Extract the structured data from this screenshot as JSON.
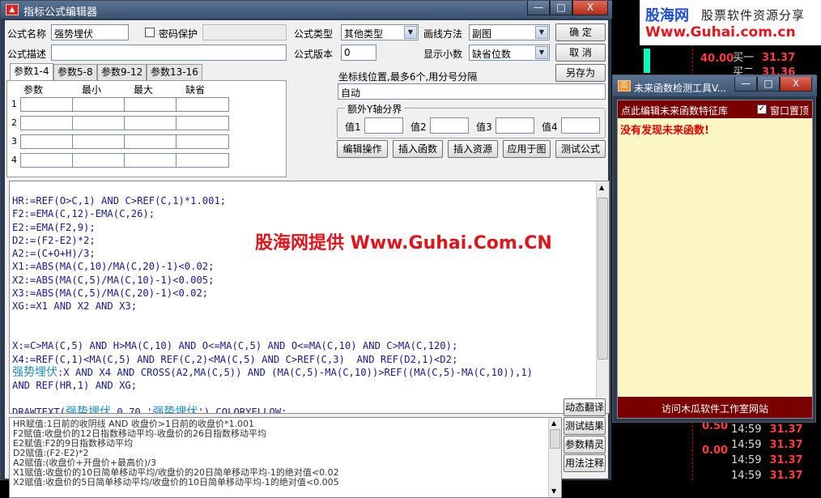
{
  "watermark": {
    "site_cn": "股海网",
    "slogan": "股票软件资源分享",
    "url": "Www.Guhai.com.cn",
    "overlay": "股海网提供 Www.Guhai.Com.CN"
  },
  "background_panel": {
    "rows": [
      {
        "label": "",
        "value": "40.00",
        "color": "#ff3b3b"
      },
      {
        "label": "买一",
        "value": "31.37",
        "color": "#ff3b3b"
      },
      {
        "label": "买二",
        "value": "31.36",
        "color": "#ff3b3b"
      },
      {
        "label": "",
        "value": "0.50",
        "color": "#ff3b3b"
      },
      {
        "label": "",
        "value": "0.00",
        "color": "#ff3b3b"
      },
      {
        "label": "14:59",
        "value": "31.37",
        "color": "#ff3b3b"
      },
      {
        "label": "14:59",
        "value": "31.37",
        "color": "#ff3b3b"
      },
      {
        "label": "14:59",
        "value": "31.37",
        "color": "#ff3b3b"
      },
      {
        "label": "14:59",
        "value": "31.37",
        "color": "#ff3b3b"
      }
    ]
  },
  "main_window": {
    "title": "指标公式编辑器",
    "controls": {
      "minimize": "—",
      "maximize": "□",
      "close": "X"
    },
    "formula_name_label": "公式名称",
    "formula_name_value": "强势埋伏",
    "password_label": "密码保护",
    "password_checked": false,
    "formula_desc_label": "公式描述",
    "formula_desc_value": "",
    "formula_type_label": "公式类型",
    "formula_type_value": "其他类型",
    "draw_method_label": "画线方法",
    "draw_method_value": "副图",
    "formula_version_label": "公式版本",
    "formula_version_value": "0",
    "decimal_label": "显示小数",
    "decimal_value": "缺省位数",
    "btn_ok": "确  定",
    "btn_cancel": "取  消",
    "btn_save_as": "另存为",
    "tabs": [
      "参数1-4",
      "参数5-8",
      "参数9-12",
      "参数13-16"
    ],
    "param_headers": [
      "参数",
      "最小",
      "最大",
      "缺省"
    ],
    "param_rows": [
      "1",
      "2",
      "3",
      "4"
    ],
    "axis_label": "坐标线位置,最多6个,用分号分隔",
    "axis_value": "自动",
    "extra_axis_label": "额外Y轴分界",
    "extra_values": [
      "值1",
      "值2",
      "值3",
      "值4"
    ],
    "action_buttons": [
      "编辑操作",
      "插入函数",
      "插入资源",
      "应用于图",
      "测试公式"
    ],
    "code_lines": [
      [
        {
          "t": "HR:=REF(O>C,1) AND C>REF(C,1)*1.001;",
          "c": "#1a1a8c"
        }
      ],
      [
        {
          "t": "F2:=EMA(C,12)-EMA(C,26);",
          "c": "#1a1a8c"
        }
      ],
      [
        {
          "t": "E2:=EMA(F2,9);",
          "c": "#1a1a8c"
        }
      ],
      [
        {
          "t": "D2:=(F2-E2)*2;",
          "c": "#1a1a8c"
        }
      ],
      [
        {
          "t": "A2:=(C+O+H)/3;",
          "c": "#1a1a8c"
        }
      ],
      [
        {
          "t": "X1:=ABS(MA(C,10)/MA(C,20)-1)<0.02;",
          "c": "#1a1a8c"
        }
      ],
      [
        {
          "t": "X2:=ABS(MA(C,5)/MA(C,10)-1)<0.005;",
          "c": "#1a1a8c"
        }
      ],
      [
        {
          "t": "X3:=ABS(MA(C,5)/MA(C,20)-1)<0.02;",
          "c": "#1a1a8c"
        }
      ],
      [
        {
          "t": "XG:=X1 AND X2 AND X3;",
          "c": "#1a1a8c"
        }
      ],
      [
        {
          "t": "",
          "c": "#1a1a8c"
        }
      ],
      [
        {
          "t": "",
          "c": "#1a1a8c"
        }
      ],
      [
        {
          "t": "X:=C>MA(C,5) AND H>MA(C,10) AND O<=MA(C,5) AND O<=MA(C,10) AND C>MA(C,120);",
          "c": "#1a1a8c"
        }
      ],
      [
        {
          "t": "X4:=REF(C,1)<MA(C,5) AND REF(C,2)<MA(C,5) AND C>REF(C,3)  AND REF(D2,1)<D2;",
          "c": "#1a1a8c"
        }
      ],
      [
        {
          "t": "强势埋伏",
          "c": "#1d8fc4"
        },
        {
          "t": ":X AND X4 AND CROSS(A2,MA(C,5)) AND (MA(C,5)-MA(C,10))>REF((MA(C,5)-MA(C,10)),1)",
          "c": "#1a1a8c"
        }
      ],
      [
        {
          "t": "AND REF(HR,1) AND XG;",
          "c": "#1a1a8c"
        }
      ],
      [
        {
          "t": "",
          "c": "#1a1a8c"
        }
      ],
      [
        {
          "t": "DRAWTEXT(",
          "c": "#1a1a8c"
        },
        {
          "t": "强势埋伏",
          "c": "#1d8fc4"
        },
        {
          "t": ",0.70,'",
          "c": "#1a1a8c"
        },
        {
          "t": "强势埋伏",
          "c": "#1d8fc4"
        },
        {
          "t": "'),COLORYELLOW;",
          "c": "#1a1a8c"
        }
      ]
    ],
    "translation_lines": [
      "HR赋值:1日前的收阴线 AND 收盘价>1日前的收盘价*1.001",
      "F2赋值:收盘价的12日指数移动平均-收盘价的26日指数移动平均",
      "E2赋值:F2的9日指数移动平均",
      "D2赋值:(F2-E2)*2",
      "A2赋值:(收盘价+开盘价+最高价)/3",
      "X1赋值:收盘价的10日简单移动平均/收盘价的20日简单移动平均-1的绝对值<0.02",
      "X2赋值:收盘价的5日简单移动平均/收盘价的10日简单移动平均-1的绝对值<0.005"
    ],
    "side_buttons": [
      "动态翻译",
      "测试结果",
      "参数精灵",
      "用法注释"
    ]
  },
  "detector_window": {
    "title": "未来函数检测工具V...",
    "icon_text": "瓜",
    "hint": "点此编辑未来函数特征库",
    "topmost_label": "窗口置顶",
    "topmost_checked": true,
    "result": "没有发现未来函数!",
    "footer": "访问木瓜软件工作室网站",
    "controls": {
      "minimize": "—",
      "maximize": "□",
      "close": "X"
    }
  },
  "colors": {
    "code_text": "#1a1a8c",
    "code_highlight": "#1d8fc4",
    "detector_result": "#e00000",
    "detector_bar": "#7a0000",
    "window_frame": "#2c3d52"
  }
}
